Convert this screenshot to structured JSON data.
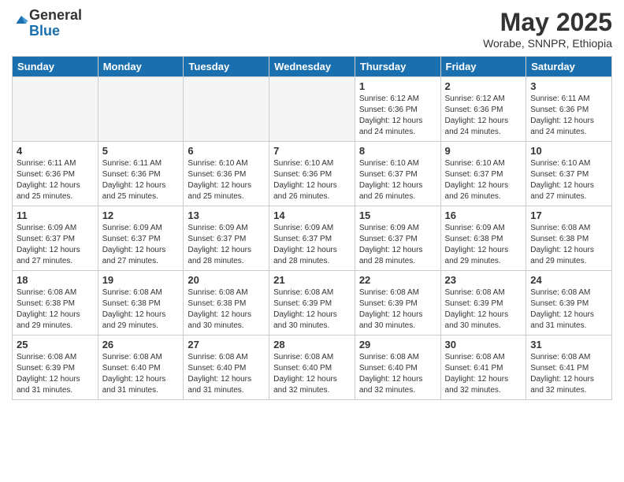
{
  "logo": {
    "general": "General",
    "blue": "Blue"
  },
  "header": {
    "title": "May 2025",
    "location": "Worabe, SNNPR, Ethiopia"
  },
  "days_of_week": [
    "Sunday",
    "Monday",
    "Tuesday",
    "Wednesday",
    "Thursday",
    "Friday",
    "Saturday"
  ],
  "weeks": [
    [
      {
        "day": "",
        "info": ""
      },
      {
        "day": "",
        "info": ""
      },
      {
        "day": "",
        "info": ""
      },
      {
        "day": "",
        "info": ""
      },
      {
        "day": "1",
        "sunrise": "6:12 AM",
        "sunset": "6:36 PM",
        "daylight": "12 hours and 24 minutes."
      },
      {
        "day": "2",
        "sunrise": "6:12 AM",
        "sunset": "6:36 PM",
        "daylight": "12 hours and 24 minutes."
      },
      {
        "day": "3",
        "sunrise": "6:11 AM",
        "sunset": "6:36 PM",
        "daylight": "12 hours and 24 minutes."
      }
    ],
    [
      {
        "day": "4",
        "sunrise": "6:11 AM",
        "sunset": "6:36 PM",
        "daylight": "12 hours and 25 minutes."
      },
      {
        "day": "5",
        "sunrise": "6:11 AM",
        "sunset": "6:36 PM",
        "daylight": "12 hours and 25 minutes."
      },
      {
        "day": "6",
        "sunrise": "6:10 AM",
        "sunset": "6:36 PM",
        "daylight": "12 hours and 25 minutes."
      },
      {
        "day": "7",
        "sunrise": "6:10 AM",
        "sunset": "6:36 PM",
        "daylight": "12 hours and 26 minutes."
      },
      {
        "day": "8",
        "sunrise": "6:10 AM",
        "sunset": "6:37 PM",
        "daylight": "12 hours and 26 minutes."
      },
      {
        "day": "9",
        "sunrise": "6:10 AM",
        "sunset": "6:37 PM",
        "daylight": "12 hours and 26 minutes."
      },
      {
        "day": "10",
        "sunrise": "6:10 AM",
        "sunset": "6:37 PM",
        "daylight": "12 hours and 27 minutes."
      }
    ],
    [
      {
        "day": "11",
        "sunrise": "6:09 AM",
        "sunset": "6:37 PM",
        "daylight": "12 hours and 27 minutes."
      },
      {
        "day": "12",
        "sunrise": "6:09 AM",
        "sunset": "6:37 PM",
        "daylight": "12 hours and 27 minutes."
      },
      {
        "day": "13",
        "sunrise": "6:09 AM",
        "sunset": "6:37 PM",
        "daylight": "12 hours and 28 minutes."
      },
      {
        "day": "14",
        "sunrise": "6:09 AM",
        "sunset": "6:37 PM",
        "daylight": "12 hours and 28 minutes."
      },
      {
        "day": "15",
        "sunrise": "6:09 AM",
        "sunset": "6:37 PM",
        "daylight": "12 hours and 28 minutes."
      },
      {
        "day": "16",
        "sunrise": "6:09 AM",
        "sunset": "6:38 PM",
        "daylight": "12 hours and 29 minutes."
      },
      {
        "day": "17",
        "sunrise": "6:08 AM",
        "sunset": "6:38 PM",
        "daylight": "12 hours and 29 minutes."
      }
    ],
    [
      {
        "day": "18",
        "sunrise": "6:08 AM",
        "sunset": "6:38 PM",
        "daylight": "12 hours and 29 minutes."
      },
      {
        "day": "19",
        "sunrise": "6:08 AM",
        "sunset": "6:38 PM",
        "daylight": "12 hours and 29 minutes."
      },
      {
        "day": "20",
        "sunrise": "6:08 AM",
        "sunset": "6:38 PM",
        "daylight": "12 hours and 30 minutes."
      },
      {
        "day": "21",
        "sunrise": "6:08 AM",
        "sunset": "6:39 PM",
        "daylight": "12 hours and 30 minutes."
      },
      {
        "day": "22",
        "sunrise": "6:08 AM",
        "sunset": "6:39 PM",
        "daylight": "12 hours and 30 minutes."
      },
      {
        "day": "23",
        "sunrise": "6:08 AM",
        "sunset": "6:39 PM",
        "daylight": "12 hours and 30 minutes."
      },
      {
        "day": "24",
        "sunrise": "6:08 AM",
        "sunset": "6:39 PM",
        "daylight": "12 hours and 31 minutes."
      }
    ],
    [
      {
        "day": "25",
        "sunrise": "6:08 AM",
        "sunset": "6:39 PM",
        "daylight": "12 hours and 31 minutes."
      },
      {
        "day": "26",
        "sunrise": "6:08 AM",
        "sunset": "6:40 PM",
        "daylight": "12 hours and 31 minutes."
      },
      {
        "day": "27",
        "sunrise": "6:08 AM",
        "sunset": "6:40 PM",
        "daylight": "12 hours and 31 minutes."
      },
      {
        "day": "28",
        "sunrise": "6:08 AM",
        "sunset": "6:40 PM",
        "daylight": "12 hours and 32 minutes."
      },
      {
        "day": "29",
        "sunrise": "6:08 AM",
        "sunset": "6:40 PM",
        "daylight": "12 hours and 32 minutes."
      },
      {
        "day": "30",
        "sunrise": "6:08 AM",
        "sunset": "6:41 PM",
        "daylight": "12 hours and 32 minutes."
      },
      {
        "day": "31",
        "sunrise": "6:08 AM",
        "sunset": "6:41 PM",
        "daylight": "12 hours and 32 minutes."
      }
    ]
  ]
}
